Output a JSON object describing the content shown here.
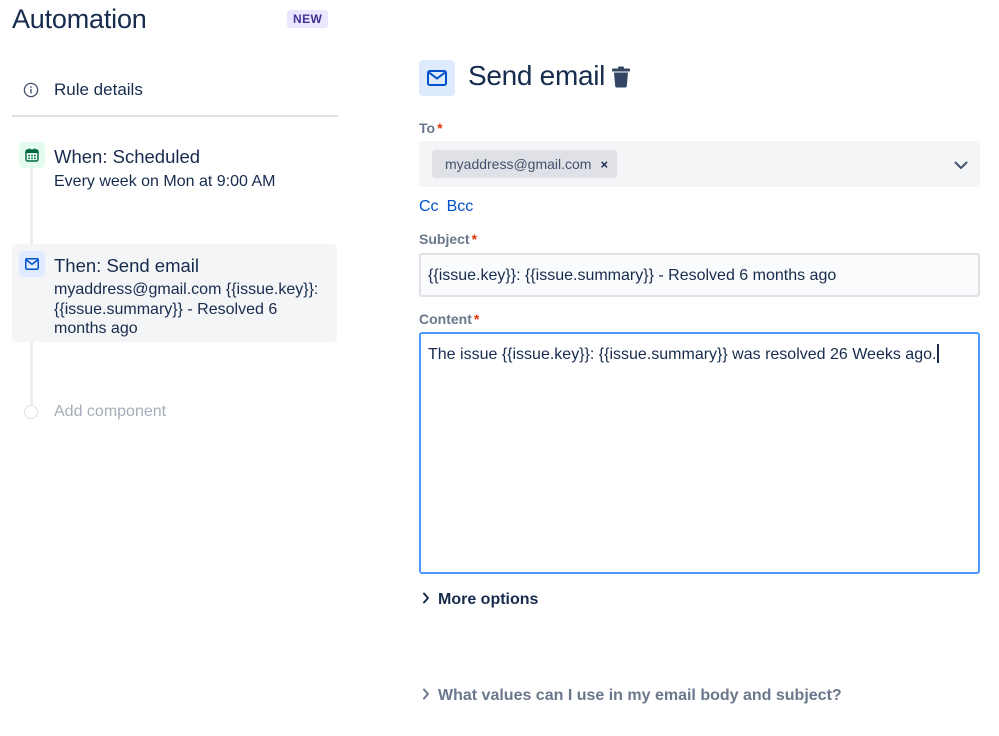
{
  "app": {
    "title": "Automation",
    "badge": "NEW"
  },
  "sidebar": {
    "rule_details_label": "Rule details",
    "steps": [
      {
        "title": "When: Scheduled",
        "subtitle": "Every week on Mon at 9:00 AM",
        "icon": "calendar-icon",
        "icon_color": "#006644"
      },
      {
        "title": "Then: Send email",
        "subtitle": "myaddress@gmail.com {{issue.key}}: {{issue.summary}} - Resolved 6 months ago",
        "icon": "mail-icon",
        "icon_color": "#0052cc",
        "selected": true
      }
    ],
    "add_component_label": "Add component"
  },
  "editor": {
    "title": "Send email",
    "to": {
      "label": "To",
      "required_mark": "*",
      "recipients": [
        "myaddress@gmail.com"
      ],
      "remove_glyph": "×"
    },
    "cc_label": "Cc",
    "bcc_label": "Bcc",
    "subject": {
      "label": "Subject",
      "required_mark": "*",
      "value": "{{issue.key}}: {{issue.summary}} - Resolved 6 months ago"
    },
    "content": {
      "label": "Content",
      "required_mark": "*",
      "value": "The issue {{issue.key}}: {{issue.summary}} was resolved 26 Weeks ago."
    },
    "more_options_label": "More options",
    "help_label": "What values can I use in my email body and subject?"
  },
  "colors": {
    "accent": "#0052cc",
    "required": "#de350b",
    "focus_border": "#4c9aff",
    "text": "#172b4d",
    "muted_text": "#6b778c",
    "badge_bg": "#eae6ff"
  }
}
